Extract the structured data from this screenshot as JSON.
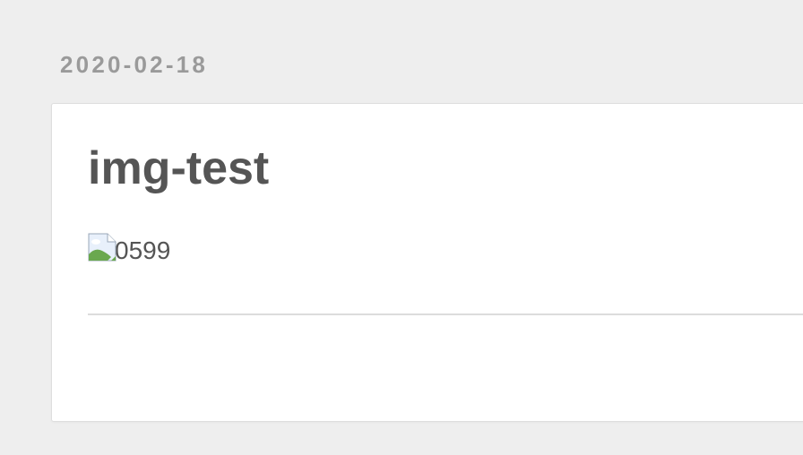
{
  "post": {
    "date": "2020-02-18",
    "title": "img-test",
    "image_alt": "0599",
    "image_icon": "broken-image-icon"
  },
  "colors": {
    "background": "#eeeeee",
    "card": "#ffffff",
    "date_text": "#9a9a9a",
    "body_text": "#555555",
    "divider": "#dcdcdc"
  }
}
